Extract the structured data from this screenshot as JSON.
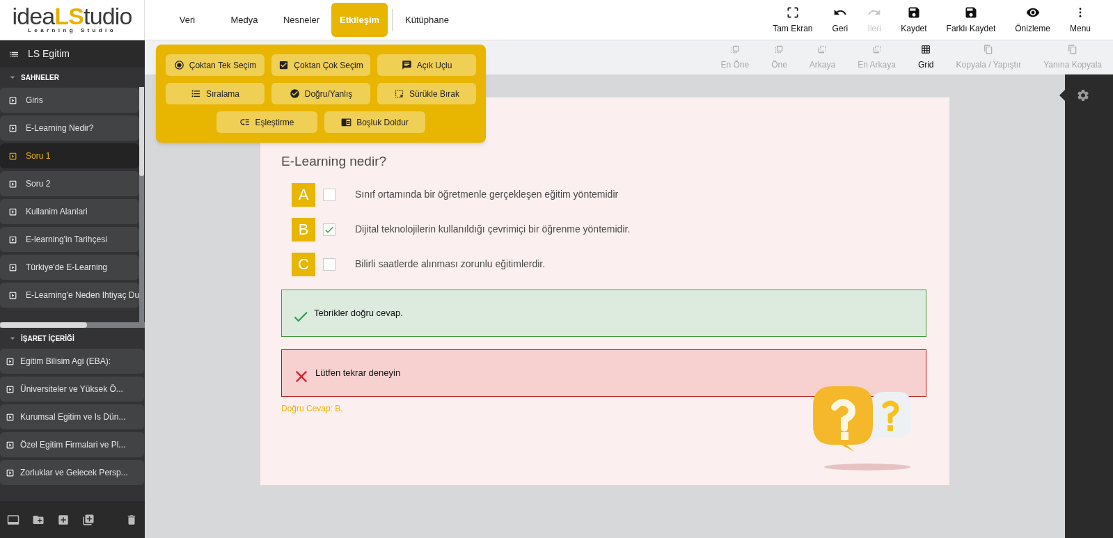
{
  "logo": {
    "text_1": "idea",
    "text_2": "LS",
    "text_3": "tudio",
    "tagline": "Learning Studio"
  },
  "nav_tabs": [
    {
      "label": "Veri",
      "selected": false
    },
    {
      "label": "Medya",
      "selected": false
    },
    {
      "label": "Nesneler",
      "selected": false
    },
    {
      "label": "Etkileşim",
      "selected": true
    },
    {
      "label": "Kütüphane",
      "selected": false
    }
  ],
  "toolbar": [
    {
      "label": "Tam Ekran",
      "disabled": false
    },
    {
      "label": "Geri",
      "disabled": false
    },
    {
      "label": "İleri",
      "disabled": true
    },
    {
      "label": "Kaydet",
      "disabled": false
    },
    {
      "label": "Farklı Kaydet",
      "disabled": false
    },
    {
      "label": "Önizleme",
      "disabled": false
    },
    {
      "label": "Menu",
      "disabled": false
    }
  ],
  "arrange_toolbar": [
    {
      "label": "En Öne",
      "disabled": true
    },
    {
      "label": "Öne",
      "disabled": true
    },
    {
      "label": "Arkaya",
      "disabled": true
    },
    {
      "label": "En Arkaya",
      "disabled": true
    },
    {
      "label": "Grid",
      "disabled": false
    },
    {
      "label": "Kopyala / Yapıştır",
      "disabled": true
    },
    {
      "label": "Yanına Kopyala",
      "disabled": true
    }
  ],
  "interaction_menu": [
    "Çoktan Tek Seçim",
    "Çoktan Çok Seçim",
    "Açık Uçlu",
    "Sıralama",
    "Doğru/Yanlış",
    "Sürükle Bırak",
    "Eşleştirme",
    "Boşluk Doldur"
  ],
  "sidebar": {
    "project": "LS Egitim",
    "scenes_heading": "SAHNELER",
    "scenes": [
      {
        "label": "Giris",
        "selected": false
      },
      {
        "label": "E-Learning Nedir?",
        "selected": false
      },
      {
        "label": "Soru 1",
        "selected": true
      },
      {
        "label": "Soru 2",
        "selected": false
      },
      {
        "label": "Kullanim Alanlari",
        "selected": false
      },
      {
        "label": "E-learning'in Tarihçesi",
        "selected": false
      },
      {
        "label": "Türkiye'de E-Learning",
        "selected": false
      },
      {
        "label": "E-Learning'e Neden Ihtiyaç Du",
        "selected": false
      }
    ],
    "markers_heading": "İŞARET İÇERİĞİ",
    "markers": [
      "Egitim Bilisim Agi (EBA):",
      "Üniversiteler ve Yüksek Ö...",
      "Kurumsal Egitim ve Is Dün...",
      "Özel Egitim Firmalari ve Pl...",
      "Zorluklar ve Gelecek Persp..."
    ]
  },
  "question": {
    "title": "E-Learning nedir?",
    "options": [
      {
        "letter": "A",
        "text": "Sınıf ortamında bir öğretmenle gerçekleşen eğitim yöntemidir",
        "checked": false
      },
      {
        "letter": "B",
        "text": "Dijital teknolojilerin kullanıldığı çevrimiçi bir öğrenme yöntemidir.",
        "checked": true
      },
      {
        "letter": "C",
        "text": "Bilirli saatlerde alınması zorunlu eğitimlerdir.",
        "checked": false
      }
    ],
    "feedback": [
      {
        "kind": "correct",
        "text": "Tebrikler doğru cevap."
      },
      {
        "kind": "incorrect",
        "text": "Lütfen tekrar deneyin"
      }
    ],
    "answer": "Doğru Cevap: B."
  }
}
